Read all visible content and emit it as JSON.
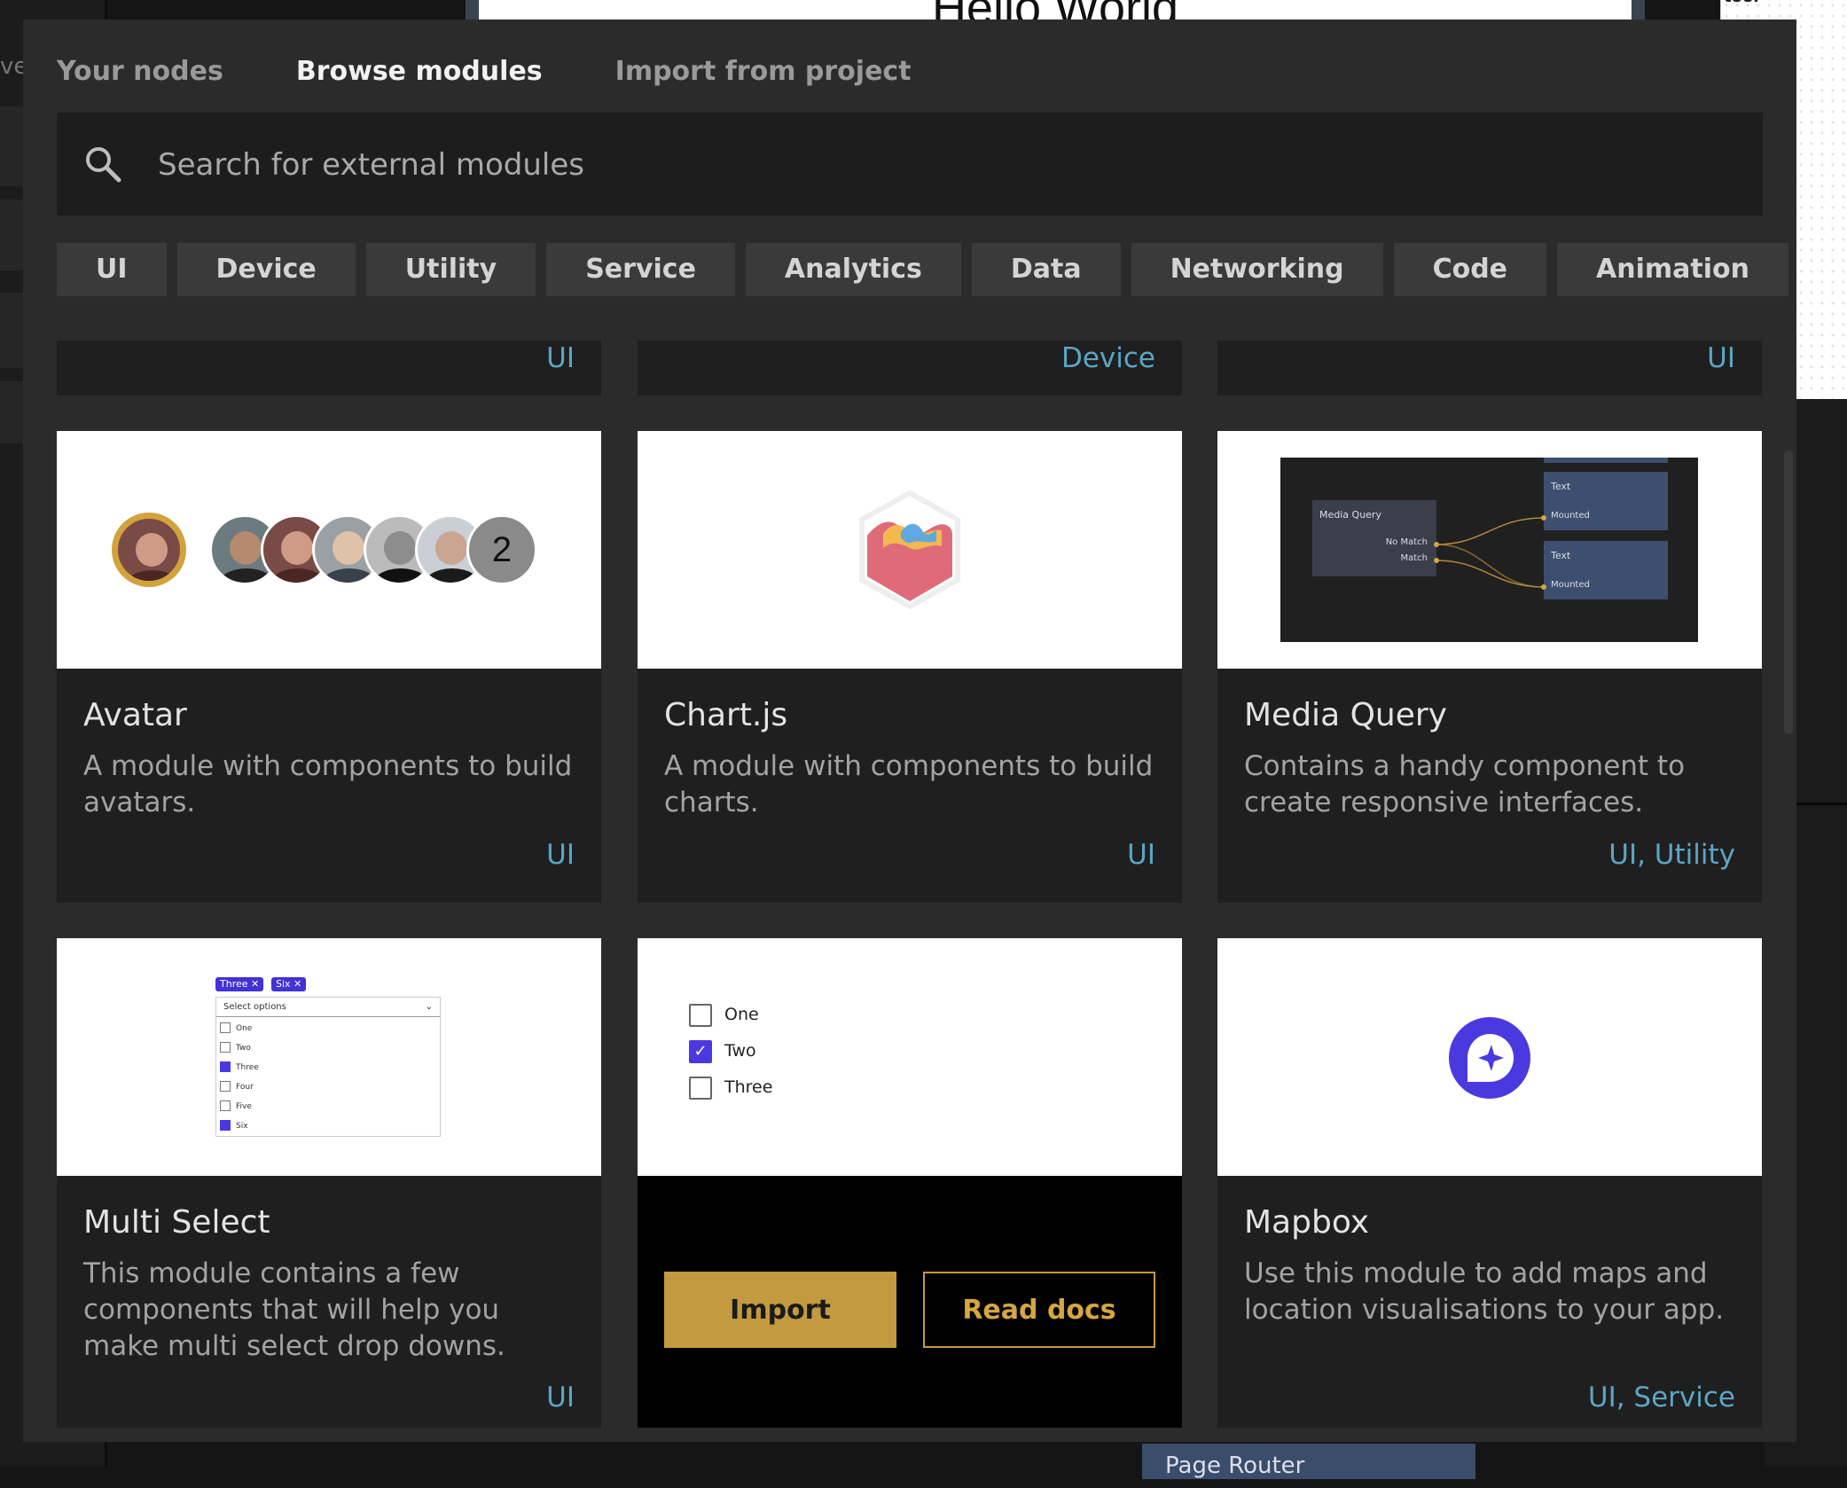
{
  "background": {
    "left_label": "ve",
    "canvas_heading": "Hello World",
    "right_label": "tool",
    "bottom_item": "Page Router"
  },
  "tabs": [
    {
      "label": "Your nodes",
      "active": false
    },
    {
      "label": "Browse modules",
      "active": true
    },
    {
      "label": "Import from project",
      "active": false
    }
  ],
  "search": {
    "placeholder": "Search for external modules",
    "icon": "search-icon"
  },
  "filters": [
    "UI",
    "Device",
    "Utility",
    "Service",
    "Analytics",
    "Data",
    "Networking",
    "Code",
    "Animation"
  ],
  "top_row_tags": [
    "UI",
    "Device",
    "UI"
  ],
  "modules": [
    {
      "title": "Avatar",
      "description": "A module with components to build avatars.",
      "tags": "UI",
      "preview": "avatar-group"
    },
    {
      "title": "Chart.js",
      "description": "A module with components to build charts.",
      "tags": "UI",
      "preview": "chartjs-logo"
    },
    {
      "title": "Media Query",
      "description": "Contains a handy component to create responsive interfaces.",
      "tags": "UI, Utility",
      "preview": "node-graph"
    },
    {
      "title": "Multi Select",
      "description": "This module contains a few components that will help you make multi select drop downs.",
      "tags": "UI",
      "preview": "multi-select-dropdown"
    },
    {
      "title": "",
      "description": "",
      "tags": "",
      "preview": "checkbox-list"
    },
    {
      "title": "Mapbox",
      "description": "Use this module to add maps and location visualisations to your app.",
      "tags": "UI, Service",
      "preview": "mapbox-logo"
    }
  ],
  "avatar_preview": {
    "overflow_count": "2"
  },
  "media_query_preview": {
    "main_node": "Media Query",
    "port_no_match": "No Match",
    "port_match": "Match",
    "text_node": "Text",
    "mounted_port": "Mounted"
  },
  "multiselect_preview": {
    "chips": [
      "Three",
      "Six"
    ],
    "header": "Select options",
    "options": [
      {
        "label": "One",
        "checked": false
      },
      {
        "label": "Two",
        "checked": false
      },
      {
        "label": "Three",
        "checked": true
      },
      {
        "label": "Four",
        "checked": false
      },
      {
        "label": "Five",
        "checked": false
      },
      {
        "label": "Six",
        "checked": true
      }
    ]
  },
  "checkbox_preview": {
    "options": [
      {
        "label": "One",
        "checked": false
      },
      {
        "label": "Two",
        "checked": true
      },
      {
        "label": "Three",
        "checked": false
      }
    ]
  },
  "hover_actions": {
    "import_label": "Import",
    "docs_label": "Read docs"
  },
  "colors": {
    "accent_gold": "#c39a3f",
    "tag_blue": "#5ba6c4",
    "modal_bg": "#2b2b2b",
    "card_bg": "#1f1f1f",
    "mapbox_purple": "#4b39e0"
  }
}
